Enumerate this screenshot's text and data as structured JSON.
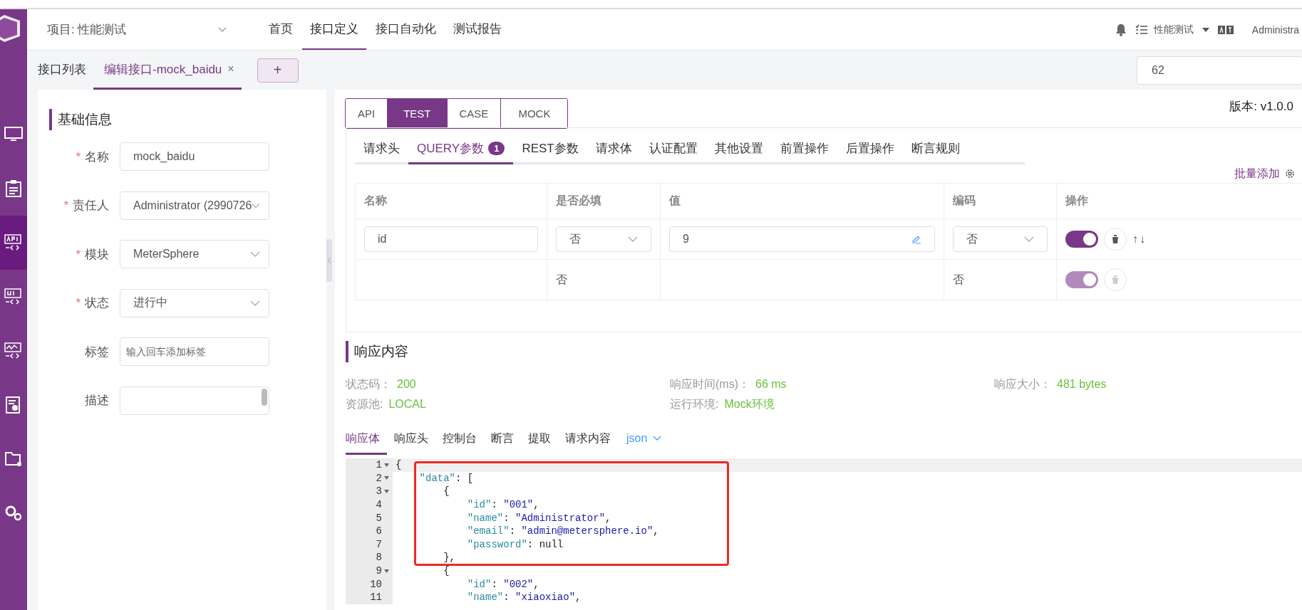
{
  "sidebar": {
    "items": [
      {
        "kind": "monitor",
        "selected": false
      },
      {
        "kind": "clipboard",
        "selected": false
      },
      {
        "kind": "api",
        "selected": true
      },
      {
        "kind": "ui",
        "selected": false
      },
      {
        "kind": "perf",
        "selected": false
      },
      {
        "kind": "report",
        "selected": false
      },
      {
        "kind": "folder",
        "selected": false
      },
      {
        "kind": "gears",
        "selected": false
      }
    ]
  },
  "header": {
    "project": "项目: 性能测试",
    "nav": [
      {
        "label": "首页",
        "selected": false
      },
      {
        "label": "接口定义",
        "selected": true
      },
      {
        "label": "接口自动化",
        "selected": false
      },
      {
        "label": "测试报告",
        "selected": false
      }
    ],
    "workspace": "性能测试",
    "user": "Administra"
  },
  "tabs": {
    "items": [
      {
        "label": "接口列表",
        "selected": false
      },
      {
        "label": "编辑接口-mock_baidu",
        "selected": true,
        "close": "×"
      }
    ],
    "add": "+",
    "search_value": "62"
  },
  "form": {
    "title": "基础信息",
    "fields": [
      {
        "label": "名称",
        "required_mark": "*",
        "kind": "input",
        "value": "mock_baidu"
      },
      {
        "label": "责任人",
        "required_mark": "*",
        "kind": "select",
        "value": "Administrator (2990726"
      },
      {
        "label": "模块",
        "required_mark": "*",
        "kind": "select",
        "value": "MeterSphere"
      },
      {
        "label": "状态",
        "required_mark": "*",
        "kind": "select",
        "value": "进行中"
      },
      {
        "label": "标签",
        "kind": "input",
        "placeholder": "输入回车添加标签"
      },
      {
        "label": "描述",
        "kind": "textarea"
      }
    ]
  },
  "version": "版本: v1.0.0",
  "mode_tabs": [
    {
      "label": "API",
      "selected": false
    },
    {
      "label": "TEST",
      "selected": true
    },
    {
      "label": "CASE",
      "selected": false
    },
    {
      "label": "MOCK",
      "selected": false
    }
  ],
  "request_tabs": [
    {
      "label": "请求头",
      "selected": false
    },
    {
      "label": "QUERY参数",
      "selected": true,
      "badge": "1"
    },
    {
      "label": "REST参数",
      "selected": false
    },
    {
      "label": "请求体",
      "selected": false
    },
    {
      "label": "认证配置",
      "selected": false
    },
    {
      "label": "其他设置",
      "selected": false
    },
    {
      "label": "前置操作",
      "selected": false
    },
    {
      "label": "后置操作",
      "selected": false
    },
    {
      "label": "断言规则",
      "selected": false
    }
  ],
  "batch_add": "批量添加",
  "table": {
    "columns": [
      "名称",
      "是否必填",
      "值",
      "编码",
      "操作"
    ],
    "rows": [
      {
        "kind": "filled",
        "name": "id",
        "required": "否",
        "value": "9",
        "encode": "否",
        "enabled": true,
        "disabled": false,
        "move": "↑↓"
      },
      {
        "kind": "empty",
        "required": "否",
        "encode": "否",
        "enabled": true,
        "disabled": true
      }
    ]
  },
  "response": {
    "title": "响应内容",
    "stats": [
      {
        "label": "状态码：",
        "value": "200"
      },
      {
        "label": "响应时间(ms)：",
        "value": "66 ms"
      },
      {
        "label": "响应大小：",
        "value": "481 bytes"
      },
      {
        "label": "资源池:",
        "value": "LOCAL"
      },
      {
        "label": "运行环境:",
        "value": "Mock环境"
      }
    ],
    "tabs": [
      {
        "label": "响应体",
        "selected": true
      },
      {
        "label": "响应头",
        "selected": false
      },
      {
        "label": "控制台",
        "selected": false
      },
      {
        "label": "断言",
        "selected": false
      },
      {
        "label": "提取",
        "selected": false
      },
      {
        "label": "请求内容",
        "selected": false
      }
    ],
    "format": "json",
    "code": [
      {
        "num": "1",
        "fold": true,
        "parts": [
          {
            "kind": "punct",
            "text": "{"
          }
        ]
      },
      {
        "num": "2",
        "fold": true,
        "parts": [
          {
            "kind": "key",
            "text": "    \"data\""
          },
          {
            "kind": "punct",
            "text": ": ["
          }
        ]
      },
      {
        "num": "3",
        "fold": true,
        "parts": [
          {
            "kind": "punct",
            "text": "        {"
          }
        ]
      },
      {
        "num": "4",
        "fold": false,
        "parts": [
          {
            "kind": "key",
            "text": "            \"id\""
          },
          {
            "kind": "punct",
            "text": ": "
          },
          {
            "kind": "str",
            "text": "\"001\""
          },
          {
            "kind": "punct",
            "text": ","
          }
        ]
      },
      {
        "num": "5",
        "fold": false,
        "parts": [
          {
            "kind": "key",
            "text": "            \"name\""
          },
          {
            "kind": "punct",
            "text": ": "
          },
          {
            "kind": "str",
            "text": "\"Administrator\""
          },
          {
            "kind": "punct",
            "text": ","
          }
        ]
      },
      {
        "num": "6",
        "fold": false,
        "parts": [
          {
            "kind": "key",
            "text": "            \"email\""
          },
          {
            "kind": "punct",
            "text": ": "
          },
          {
            "kind": "str",
            "text": "\"admin@metersphere.io\""
          },
          {
            "kind": "punct",
            "text": ","
          }
        ]
      },
      {
        "num": "7",
        "fold": false,
        "parts": [
          {
            "kind": "key",
            "text": "            \"password\""
          },
          {
            "kind": "punct",
            "text": ": null"
          }
        ]
      },
      {
        "num": "8",
        "fold": false,
        "parts": [
          {
            "kind": "punct",
            "text": "        },"
          }
        ]
      },
      {
        "num": "9",
        "fold": true,
        "parts": [
          {
            "kind": "punct",
            "text": "        {"
          }
        ]
      },
      {
        "num": "10",
        "fold": false,
        "parts": [
          {
            "kind": "key",
            "text": "            \"id\""
          },
          {
            "kind": "punct",
            "text": ": "
          },
          {
            "kind": "str",
            "text": "\"002\""
          },
          {
            "kind": "punct",
            "text": ","
          }
        ]
      },
      {
        "num": "11",
        "fold": false,
        "parts": [
          {
            "kind": "key",
            "text": "            \"name\""
          },
          {
            "kind": "punct",
            "text": ": "
          },
          {
            "kind": "str",
            "text": "\"xiaoxiao\""
          },
          {
            "kind": "punct",
            "text": ","
          }
        ]
      }
    ]
  }
}
